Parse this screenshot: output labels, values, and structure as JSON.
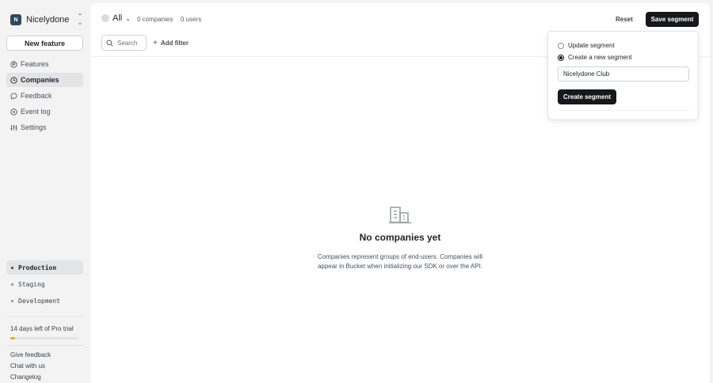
{
  "org": {
    "initial": "N",
    "name": "Nicelydone"
  },
  "sidebar": {
    "new_feature_label": "New feature",
    "nav": [
      {
        "label": "Features",
        "icon": "flag-icon",
        "active": false
      },
      {
        "label": "Companies",
        "icon": "building-icon",
        "active": true
      },
      {
        "label": "Feedback",
        "icon": "chat-icon",
        "active": false
      },
      {
        "label": "Event log",
        "icon": "clock-icon",
        "active": false
      },
      {
        "label": "Settings",
        "icon": "sliders-icon",
        "active": false
      }
    ],
    "environments": [
      {
        "label": "Production",
        "active": true
      },
      {
        "label": "Staging",
        "active": false
      },
      {
        "label": "Development",
        "active": false
      }
    ],
    "trial": {
      "text": "14 days left of Pro trial",
      "progress_fraction": 0.07,
      "color": "#f2a900"
    },
    "footer_links": [
      "Give feedback",
      "Chat with us",
      "Changelog"
    ]
  },
  "header": {
    "segment_name": "All",
    "companies_count": "0 companies",
    "users_count": "0 users",
    "reset_label": "Reset",
    "save_label": "Save segment"
  },
  "filters": {
    "search_placeholder": "Search",
    "add_filter_label": "Add filter"
  },
  "empty_state": {
    "title": "No companies yet",
    "description": "Companies represent groups of end-users. Companies will appear in Bucket when initializing our SDK or over the API."
  },
  "popover": {
    "option_update": "Update segment",
    "option_create": "Create a new segment",
    "selected": "create",
    "name_value": "Nicelydone Club",
    "create_button_label": "Create segment"
  },
  "colors": {
    "primary_button": "#16181b",
    "background": "#f3f3f3",
    "active_nav": "#e3e4e6"
  }
}
